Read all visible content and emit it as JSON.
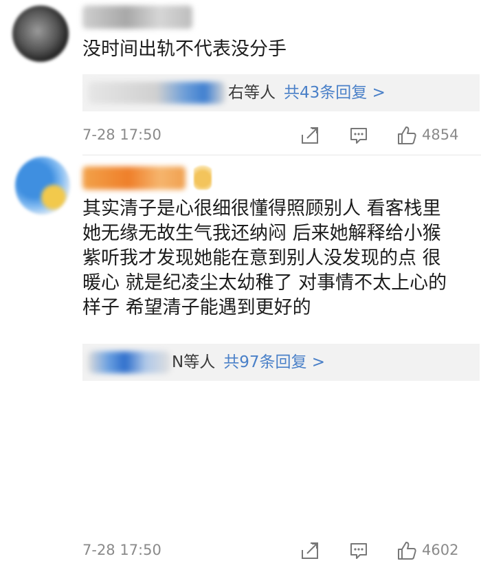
{
  "comments": [
    {
      "body_lines": [
        "没时间出轨不代表没分手"
      ],
      "reply_suffix": "右等人",
      "reply_link": "共43条回复 >",
      "time": "7-28 17:50",
      "likes": "4854"
    },
    {
      "body_lines": [
        "其实清子是心很细很懂得照顾别人 看客栈里",
        "她无缘无故生气我还纳闷 后来她解释给小猴",
        "紫听我才发现她能在意到别人没发现的点 很",
        "暖心 就是纪凌尘太幼稚了 对事情不太上心的",
        "样子 希望清子能遇到更好的"
      ],
      "reply_suffix": "N等人",
      "reply_link": "共97条回复 >",
      "time": "7-28 17:50",
      "likes": "4602"
    }
  ],
  "icons": {
    "share": "share-icon",
    "reply": "comment-icon",
    "like": "thumbs-up-icon"
  },
  "colors": {
    "link": "#4a80c8",
    "meta_text": "#8a8a8a",
    "reply_bg": "#f2f2f2"
  }
}
